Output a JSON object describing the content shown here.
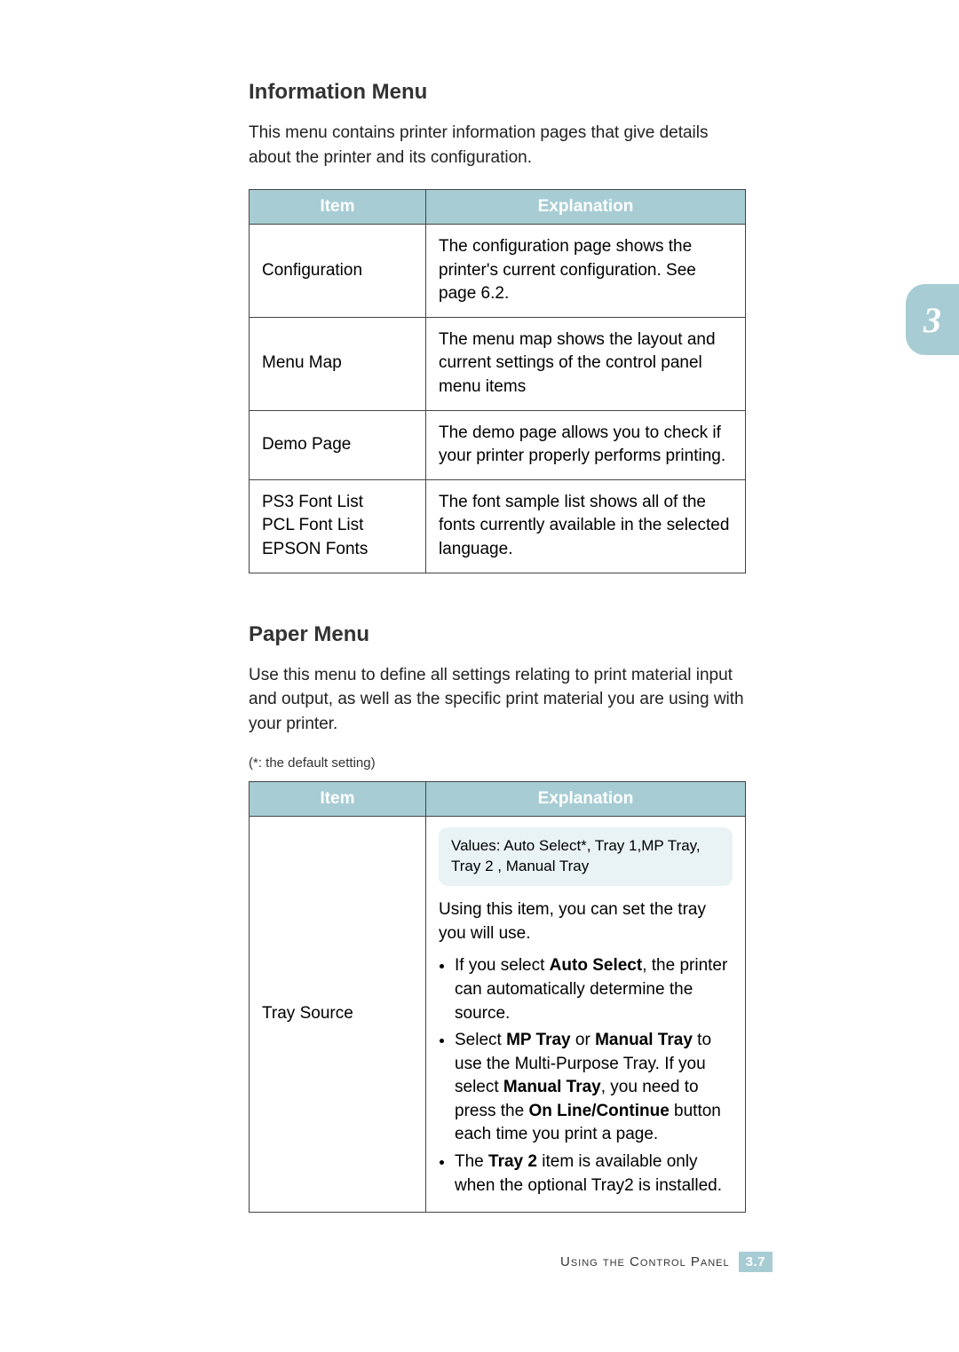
{
  "sideTab": {
    "chapter": "3"
  },
  "sections": {
    "info": {
      "heading": "Information Menu",
      "intro": "This menu contains printer information pages that give details about the printer and its configuration.",
      "table": {
        "headers": [
          "Item",
          "Explanation"
        ],
        "rows": [
          {
            "item": "Configuration",
            "explanation": "The configuration page shows the printer's current configuration. See page 6.2."
          },
          {
            "item": "Menu Map",
            "explanation": "The menu map shows the layout and current settings of the control panel menu items"
          },
          {
            "item": "Demo Page",
            "explanation": "The demo page allows you to check if your printer properly performs printing."
          },
          {
            "itemLines": [
              "PS3 Font List",
              "PCL Font List",
              "EPSON Fonts"
            ],
            "explanation": "The font sample list shows all of the fonts currently available in the selected language."
          }
        ]
      }
    },
    "paper": {
      "heading": "Paper Menu",
      "intro": "Use this menu to define all settings relating to print material input and output, as well as the specific print material you are using with your printer.",
      "defaultNote": "(*: the default setting)",
      "table": {
        "headers": [
          "Item",
          "Explanation"
        ],
        "rows": [
          {
            "item": "Tray Source",
            "valuesBox": "Values: Auto Select*, Tray 1,MP Tray, Tray 2 , Manual Tray",
            "lead": "Using this item, you can set the tray you will use.",
            "bullets": [
              {
                "pre": "If you select ",
                "b1": "Auto Select",
                "post": ", the printer can automatically determine the source."
              },
              {
                "t0": "Select ",
                "b0": "MP Tray",
                "t1": " or ",
                "b1": "Manual Tray",
                "t2": " to use the Multi-Purpose Tray. If you select ",
                "b2": "Manual Tray",
                "t3": ", you need to press the ",
                "b3": "On Line/Continue",
                "t4": " button each time you print a page."
              },
              {
                "t0": "The ",
                "b0": "Tray 2",
                "t1": " item is available only when the optional Tray2 is installed."
              }
            ]
          }
        ]
      }
    }
  },
  "footer": {
    "title": "Using the Control Panel",
    "chapter": "3",
    "dot": ".",
    "page": "7"
  }
}
